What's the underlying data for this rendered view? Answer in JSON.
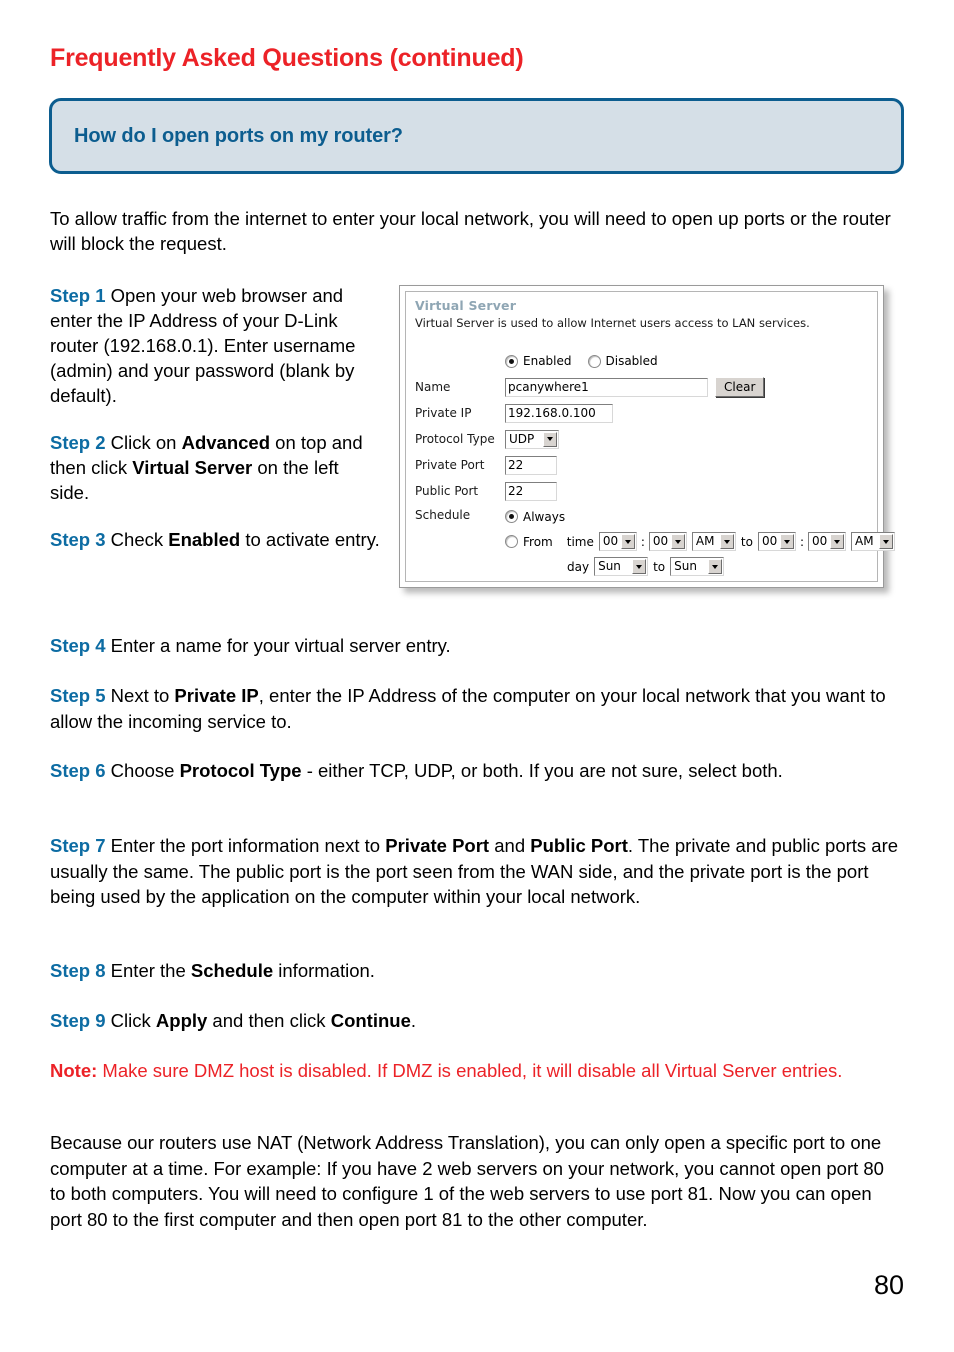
{
  "header": {
    "title": "Frequently Asked Questions (continued)"
  },
  "question_banner": {
    "text": "How do I open ports on my router?",
    "border_color": "#0c5d8f",
    "fill_color": "#d5dfe7",
    "text_color": "#0c5d8f"
  },
  "colors": {
    "heading_red": "#ec2227",
    "step_blue": "#0d6ca3",
    "note_red": "#ec2227"
  },
  "intro_paragraph": "To allow traffic from the internet to enter your local network, you will need to open up ports or the router will block the request.",
  "steps": {
    "step1": {
      "label": "Step 1",
      "text": " Open your web browser and enter the IP Address of your D-Link router (192.168.0.1). Enter username (admin) and your password (blank by default)."
    },
    "step2": {
      "label": "Step 2",
      "part1": " Click on ",
      "bold1": "Advanced",
      "part2": " on top and then click ",
      "bold2": "Virtual Server",
      "part3": " on the left side."
    },
    "step3": {
      "label": "Step 3",
      "part1": " Check ",
      "bold1": "Enabled",
      "part2": " to activate entry."
    },
    "step4": {
      "label": "Step 4",
      "text": " Enter a name for your virtual server entry."
    },
    "step5": {
      "label": "Step 5",
      "part1": " Next to ",
      "bold1": "Private IP",
      "part2": ", enter the IP Address of the computer on your local network that you want to allow the incoming service to."
    },
    "step6": {
      "label": "Step 6",
      "part1": " Choose ",
      "bold1": "Protocol Type",
      "part2": " - either TCP, UDP, or both. If you are not sure, select both."
    },
    "step7": {
      "label": "Step 7",
      "part1": " Enter the port information next to ",
      "bold1": "Private Port",
      "part2": " and ",
      "bold2": "Public Port",
      "part3": ". The private and public ports are usually the same. The public port is the port seen from the WAN side, and the private port is the port being used by the application on the computer within your local network."
    },
    "step8": {
      "label": "Step 8",
      "part1": " Enter the ",
      "bold1": "Schedule",
      "part2": " information."
    },
    "step9": {
      "label": "Step 9",
      "part1": " Click ",
      "bold1": "Apply",
      "part2": " and then click ",
      "bold2": "Continue",
      "part3": "."
    }
  },
  "note": {
    "label": "Note:",
    "text": " Make sure DMZ host is disabled. If DMZ is enabled, it will disable all Virtual Server entries."
  },
  "closing_paragraph": "Because our routers use NAT (Network Address Translation), you can only open a specific port to one computer at a time. For example: If you have 2 web servers on your network, you cannot open port 80 to both computers. You will need to configure 1 of the web servers to use port 81. Now you can open port 80 to the first computer and then open port 81 to the other computer.",
  "page_number": "80",
  "router_screenshot": {
    "panel_title": "Virtual Server",
    "panel_subtitle": "Virtual Server is used to allow Internet users access to LAN services.",
    "state": {
      "enabled_label": "Enabled",
      "disabled_label": "Disabled",
      "selected": "Enabled"
    },
    "fields": {
      "name_label": "Name",
      "name_value": "pcanywhere1",
      "clear_button": "Clear",
      "private_ip_label": "Private IP",
      "private_ip_value": "192.168.0.100",
      "protocol_label": "Protocol Type",
      "protocol_value": "UDP",
      "private_port_label": "Private Port",
      "private_port_value": "22",
      "public_port_label": "Public Port",
      "public_port_value": "22",
      "schedule_label": "Schedule"
    },
    "schedule": {
      "always_label": "Always",
      "always_selected": true,
      "from_label": "From",
      "time_label": "time",
      "from_hour": "00",
      "from_minute": "00",
      "from_ampm": "AM",
      "to_label": "to",
      "to_hour": "00",
      "to_minute": "00",
      "to_ampm": "AM",
      "colon": ":",
      "day_label": "day",
      "from_day": "Sun",
      "to_day": "Sun"
    }
  }
}
